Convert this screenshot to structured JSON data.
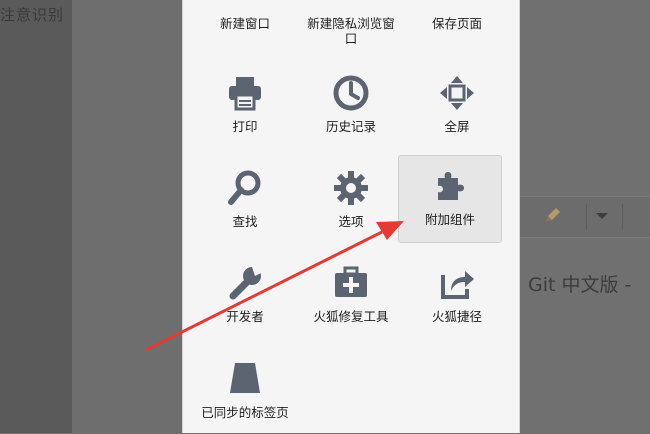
{
  "background": {
    "left_text": "注意识别",
    "right_heading": "Git 中文版 -"
  },
  "menu": {
    "items": [
      {
        "label": "新建窗口",
        "icon": "new-window-icon"
      },
      {
        "label": "新建隐私浏览窗口",
        "icon": "private-window-icon"
      },
      {
        "label": "保存页面",
        "icon": "save-page-icon"
      },
      {
        "label": "打印",
        "icon": "printer-icon"
      },
      {
        "label": "历史记录",
        "icon": "clock-icon"
      },
      {
        "label": "全屏",
        "icon": "fullscreen-icon"
      },
      {
        "label": "查找",
        "icon": "magnifier-icon"
      },
      {
        "label": "选项",
        "icon": "gear-icon"
      },
      {
        "label": "附加组件",
        "icon": "puzzle-icon"
      },
      {
        "label": "开发者",
        "icon": "wrench-icon"
      },
      {
        "label": "火狐修复工具",
        "icon": "toolbox-icon"
      },
      {
        "label": "火狐捷径",
        "icon": "share-icon"
      },
      {
        "label": "已同步的标签页",
        "icon": "synced-tabs-icon"
      }
    ],
    "highlighted_item": "附加组件"
  },
  "colors": {
    "icon": "#5b6470",
    "annotation_arrow": "#e53935",
    "highlight": "#e6e6e6"
  }
}
